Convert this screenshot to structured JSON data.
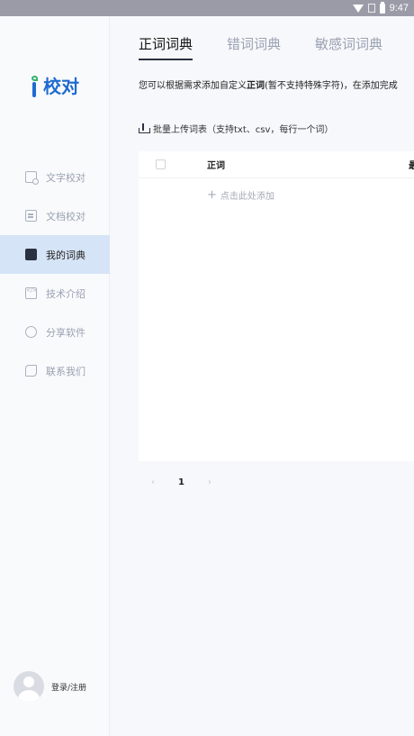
{
  "status_bar": {
    "time": "9:47"
  },
  "sidebar": {
    "logo_text": "校对",
    "items": [
      {
        "label": "文字校对",
        "icon": "text-check-icon",
        "active": false
      },
      {
        "label": "文档校对",
        "icon": "doc-check-icon",
        "active": false
      },
      {
        "label": "我的词典",
        "icon": "book-icon",
        "active": true
      },
      {
        "label": "技术介绍",
        "icon": "code-icon",
        "active": false
      },
      {
        "label": "分享软件",
        "icon": "share-icon",
        "active": false
      },
      {
        "label": "联系我们",
        "icon": "phone-icon",
        "active": false
      }
    ],
    "user_label": "登录/注册"
  },
  "tabs": [
    "正词词典",
    "错词词典",
    "敏感词词典"
  ],
  "description": {
    "prefix": "您可以根据需求添加自定义",
    "bold": "正词",
    "suffix": "(暂不支持特殊字符)，在添加完成"
  },
  "upload_label": "批量上传词表（支持txt、csv，每行一个词）",
  "table": {
    "columns": [
      "正词",
      "最"
    ],
    "add_placeholder": "点击此处添加"
  },
  "pagination": {
    "prev": "‹",
    "current": "1",
    "next": "›"
  },
  "colors": {
    "accent": "#1f6bd1",
    "active_bg": "#d6e4f7",
    "logo_green": "#2fb36e"
  }
}
